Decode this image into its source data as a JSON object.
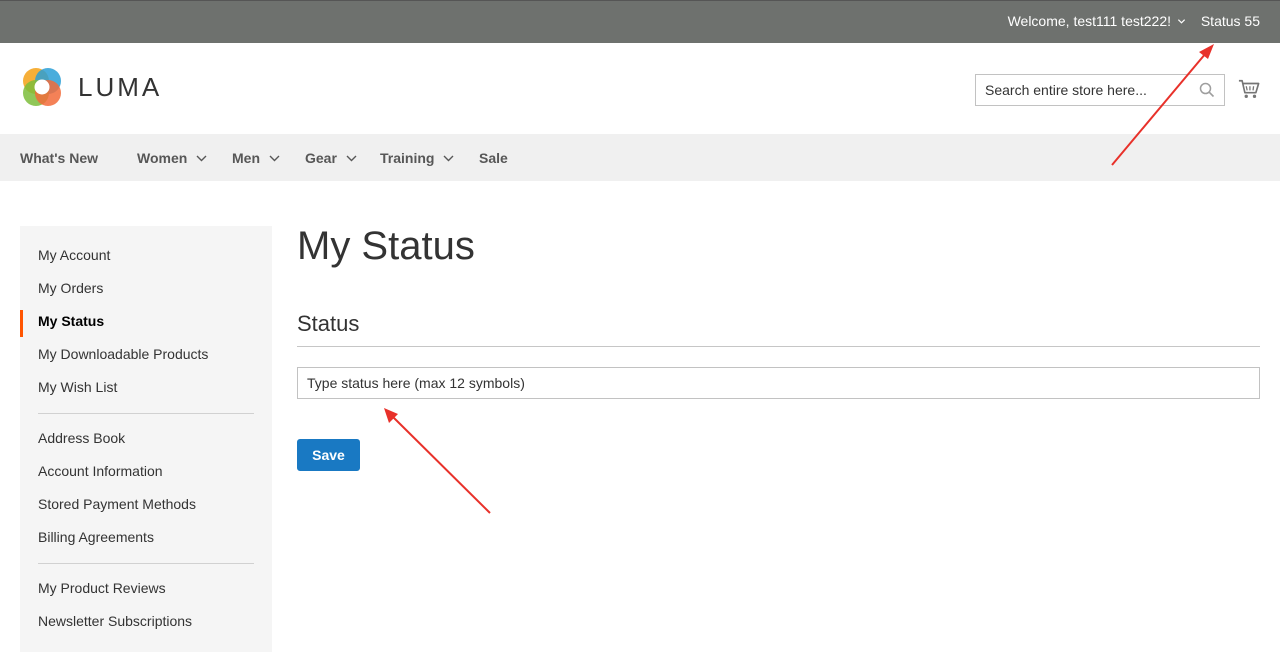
{
  "top_bar": {
    "welcome": "Welcome, test111 test222!",
    "status_link": "Status 55"
  },
  "header": {
    "logo_text": "LUMA",
    "search_placeholder": "Search entire store here..."
  },
  "nav": {
    "items": [
      {
        "label": "What's New",
        "has_submenu": false
      },
      {
        "label": "Women",
        "has_submenu": true
      },
      {
        "label": "Men",
        "has_submenu": true
      },
      {
        "label": "Gear",
        "has_submenu": true
      },
      {
        "label": "Training",
        "has_submenu": true
      },
      {
        "label": "Sale",
        "has_submenu": false
      }
    ]
  },
  "sidebar": {
    "items": [
      {
        "label": "My Account"
      },
      {
        "label": "My Orders"
      },
      {
        "label": "My Status",
        "active": true
      },
      {
        "label": "My Downloadable Products"
      },
      {
        "label": "My Wish List"
      },
      {
        "label": "Address Book"
      },
      {
        "label": "Account Information"
      },
      {
        "label": "Stored Payment Methods"
      },
      {
        "label": "Billing Agreements"
      },
      {
        "label": "My Product Reviews"
      },
      {
        "label": "Newsletter Subscriptions"
      }
    ]
  },
  "main": {
    "page_title": "My Status",
    "section_title": "Status",
    "status_input_placeholder": "Type status here (max 12 symbols)",
    "save_label": "Save"
  },
  "colors": {
    "top_bar_bg": "#6e716e",
    "nav_bg": "#f0f0f0",
    "sidebar_bg": "#f5f5f5",
    "active_indicator": "#ff5501",
    "primary_button": "#1979c3",
    "annotation_arrow": "#e8312a"
  }
}
